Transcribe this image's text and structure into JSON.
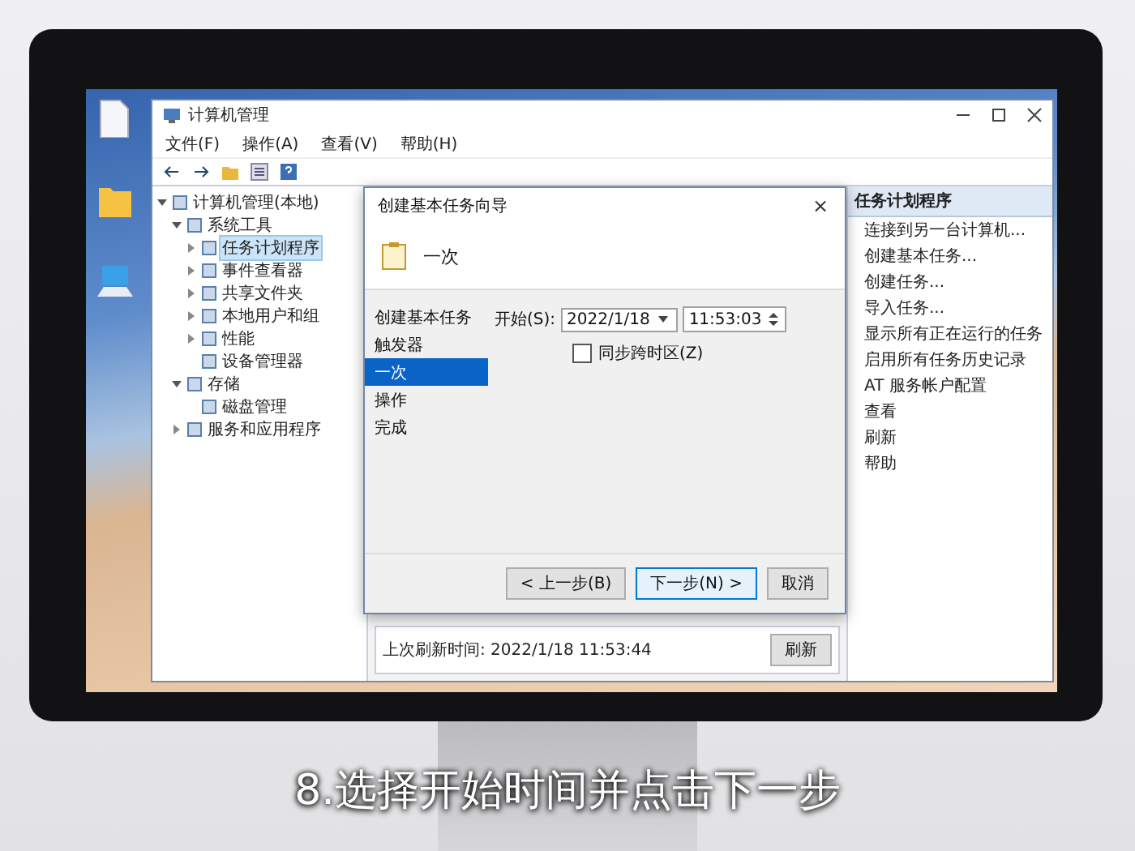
{
  "caption": "8.选择开始时间并点击下一步",
  "desktop_icons": [
    {
      "kind": "file"
    },
    {
      "kind": "folder"
    },
    {
      "kind": "computer"
    }
  ],
  "main_window": {
    "title": "计算机管理",
    "menu": [
      "文件(F)",
      "操作(A)",
      "查看(V)",
      "帮助(H)"
    ],
    "tree": [
      {
        "label": "计算机管理(本地)",
        "selected": false,
        "expanded": true,
        "children": [
          {
            "label": "系统工具",
            "selected": false,
            "expanded": true,
            "children": [
              {
                "label": "任务计划程序",
                "selected": true,
                "expanded": false
              },
              {
                "label": "事件查看器",
                "selected": false,
                "expanded": false
              },
              {
                "label": "共享文件夹",
                "selected": false,
                "expanded": false
              },
              {
                "label": "本地用户和组",
                "selected": false,
                "expanded": false
              },
              {
                "label": "性能",
                "selected": false,
                "expanded": false
              },
              {
                "label": "设备管理器",
                "selected": false
              }
            ]
          },
          {
            "label": "存储",
            "selected": false,
            "expanded": true,
            "children": [
              {
                "label": "磁盘管理",
                "selected": false
              }
            ]
          },
          {
            "label": "服务和应用程序",
            "selected": false,
            "expanded": false
          }
        ]
      }
    ],
    "status": "上次刷新时间: 2022/1/18 11:53:44",
    "refresh_button": "刷新",
    "actions_header": "任务计划程序",
    "actions": [
      "连接到另一台计算机...",
      "创建基本任务...",
      "创建任务...",
      "导入任务...",
      "显示所有正在运行的任务",
      "启用所有任务历史记录",
      "AT 服务帐户配置",
      "查看",
      "刷新",
      "帮助"
    ]
  },
  "dialog": {
    "title": "创建基本任务向导",
    "close": "×",
    "heading": "一次",
    "steps": [
      {
        "label": "创建基本任务",
        "selected": false
      },
      {
        "label": "触发器",
        "selected": false
      },
      {
        "label": "一次",
        "selected": true
      },
      {
        "label": "操作",
        "selected": false
      },
      {
        "label": "完成",
        "selected": false
      }
    ],
    "start_label": "开始(S):",
    "date": "2022/1/18",
    "time": "11:53:03",
    "sync": {
      "label": "同步跨时区(Z)",
      "checked": false
    },
    "buttons": [
      {
        "label": "< 上一步(B)",
        "default": false
      },
      {
        "label": "下一步(N) >",
        "default": true
      },
      {
        "label": "取消",
        "default": false
      }
    ]
  }
}
